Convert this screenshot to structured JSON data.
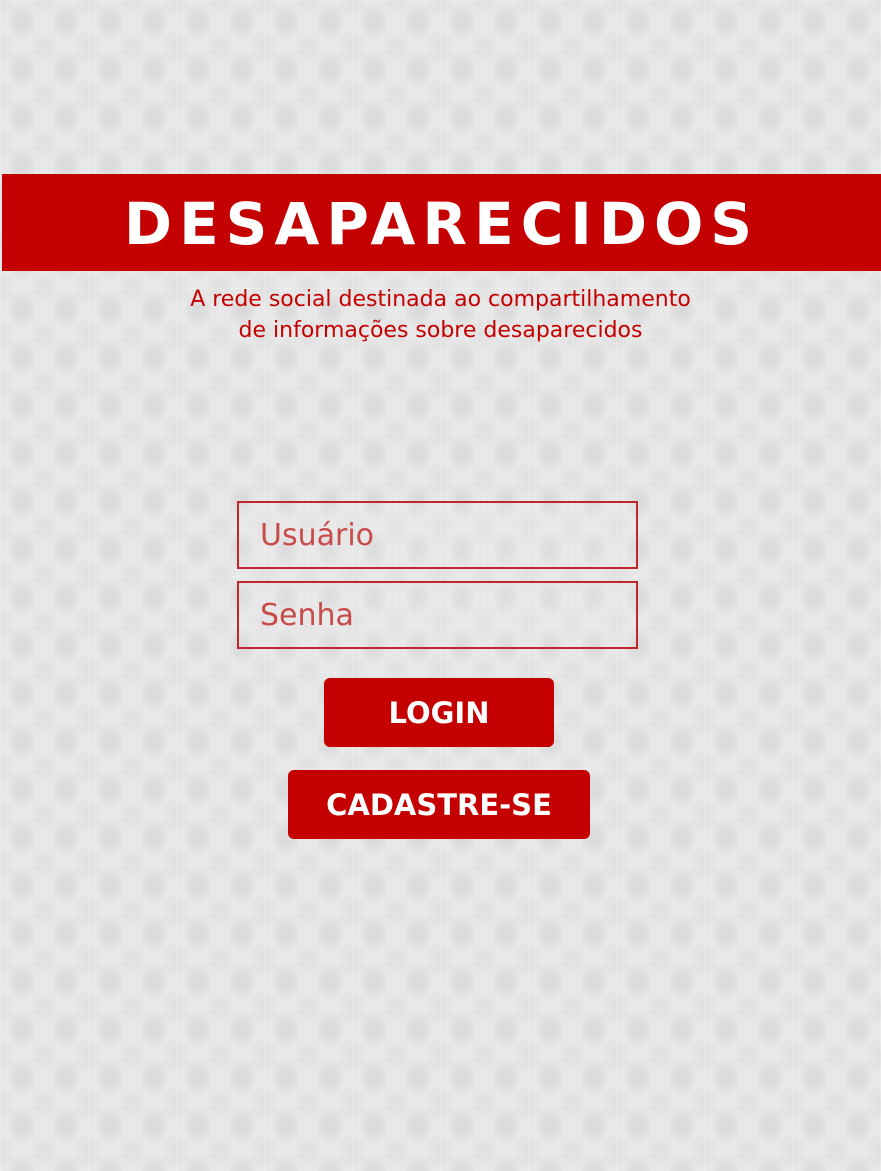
{
  "app": {
    "title": "DESAPARECIDOS",
    "subtitle_line1": "A rede social destinada ao compartilhamento",
    "subtitle_line2": "de informações sobre desaparecidos"
  },
  "form": {
    "username": {
      "value": "",
      "placeholder": "Usuário"
    },
    "password": {
      "value": "",
      "placeholder": "Senha"
    },
    "login_label": "LOGIN",
    "signup_label": "CADASTRE-SE"
  },
  "colors": {
    "accent": "#c40000",
    "field_border": "#c0272d",
    "placeholder_text": "#c84b4b",
    "background": "#e6e6e6"
  }
}
